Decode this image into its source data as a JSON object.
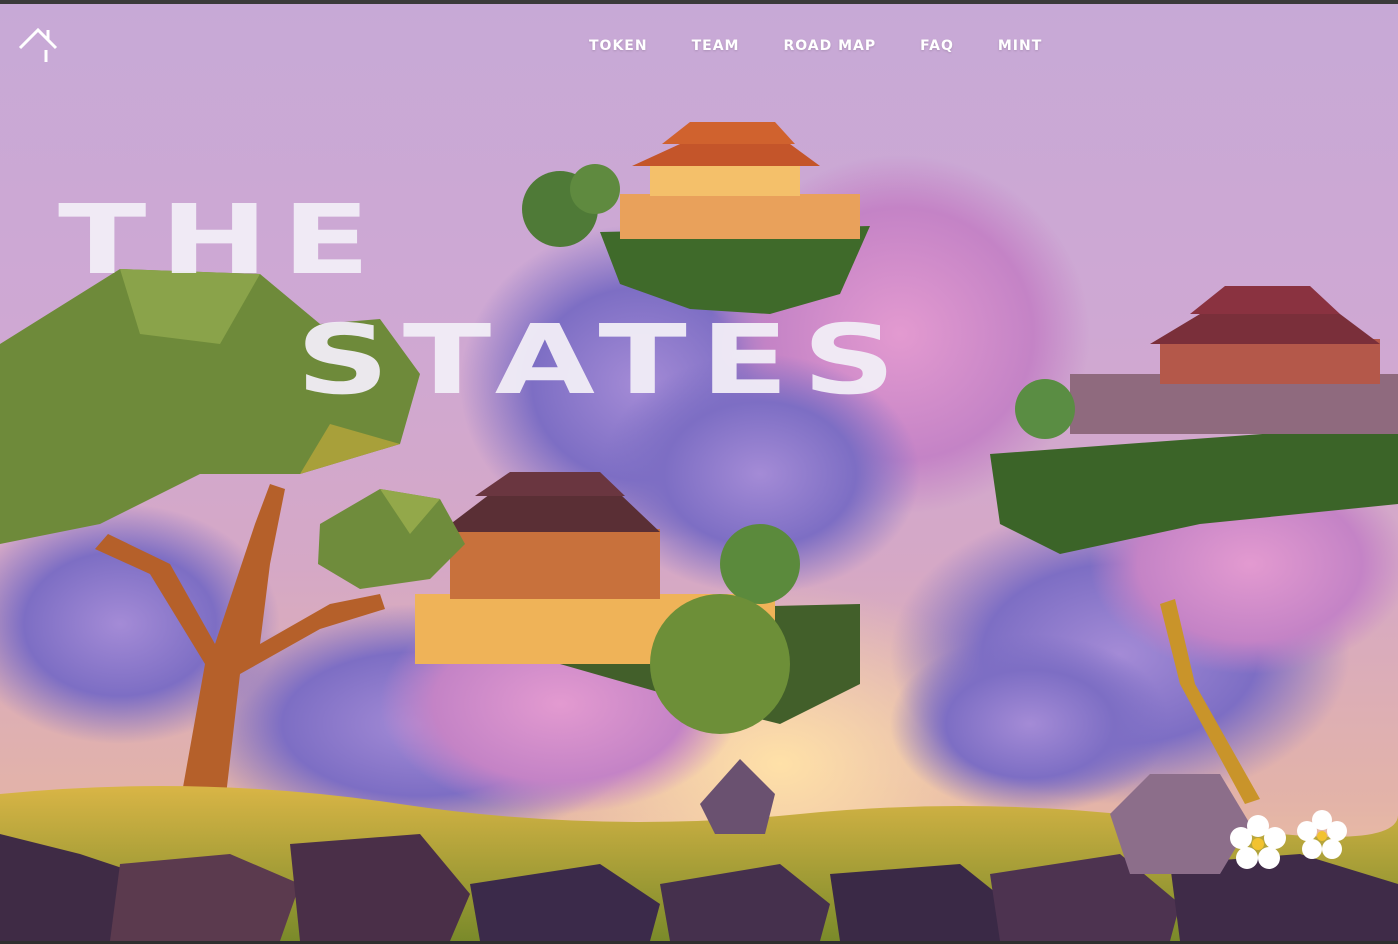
{
  "nav": {
    "logo_icon": "house-outline-icon",
    "items": [
      {
        "label": "TOKEN"
      },
      {
        "label": "TEAM"
      },
      {
        "label": "ROAD MAP"
      },
      {
        "label": "FAQ"
      },
      {
        "label": "MINT"
      }
    ]
  },
  "hero": {
    "title_line1": "THE",
    "title_line2": "STATES"
  },
  "colors": {
    "sky_top": "#c7a9d6",
    "sky_bottom": "#f1c79b",
    "cloud": "#8f7fc9",
    "cloud_pink": "#d98bc4",
    "grass": "#c9a23a",
    "rock": "#4a3450",
    "temple_roof": "#c4552a",
    "temple_wall": "#f0b55a",
    "tree_canopy": "#6e8a3a",
    "tree_trunk": "#b5602a"
  }
}
